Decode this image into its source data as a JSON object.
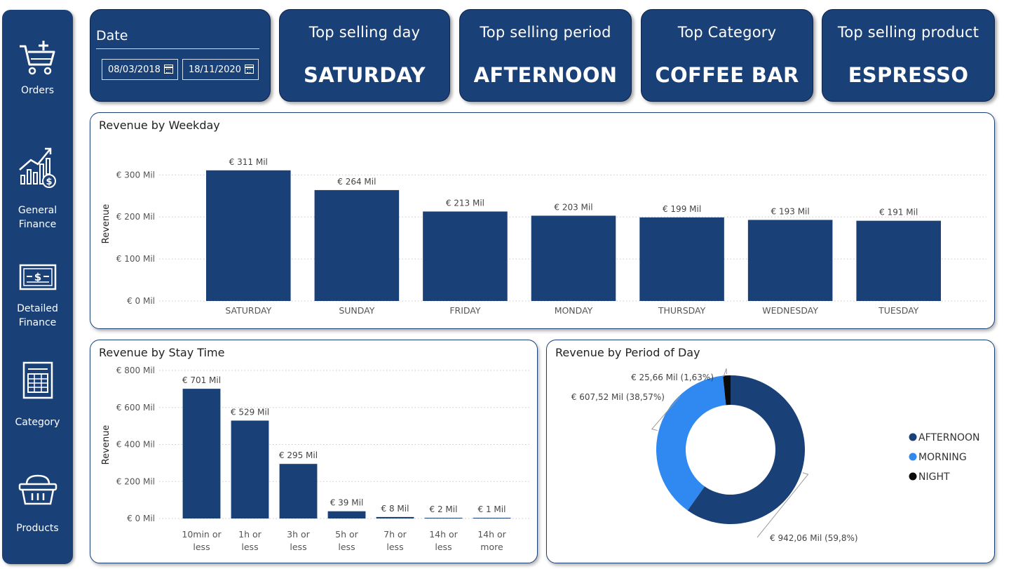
{
  "sidebar": {
    "items": [
      {
        "label": "Orders",
        "icon": "cart-plus-icon"
      },
      {
        "label": "General\nFinance",
        "icon": "finance-chart-icon"
      },
      {
        "label": "Detailed\nFinance",
        "icon": "banknote-icon"
      },
      {
        "label": "Category",
        "icon": "spreadsheet-icon"
      },
      {
        "label": "Products",
        "icon": "basket-icon"
      }
    ]
  },
  "date_filter": {
    "title": "Date",
    "start": "08/03/2018",
    "end": "18/11/2020"
  },
  "kpis": [
    {
      "title": "Top selling day",
      "value": "SATURDAY"
    },
    {
      "title": "Top selling period",
      "value": "AFTERNOON"
    },
    {
      "title": "Top Category",
      "value": "COFFEE BAR"
    },
    {
      "title": "Top selling product",
      "value": "ESPRESSO"
    }
  ],
  "colors": {
    "primary": "#1a4078",
    "morning": "#2f89f0",
    "night": "#0a0a0a",
    "gridline": "#c8c8c8"
  },
  "chart_data": [
    {
      "type": "bar",
      "title": "Revenue by Weekday",
      "ylabel": "Revenue",
      "categories": [
        "SATURDAY",
        "SUNDAY",
        "FRIDAY",
        "MONDAY",
        "THURSDAY",
        "WEDNESDAY",
        "TUESDAY"
      ],
      "values": [
        311,
        264,
        213,
        203,
        199,
        193,
        191
      ],
      "data_labels": [
        "€ 311 Mil",
        "€ 264 Mil",
        "€ 213 Mil",
        "€ 203 Mil",
        "€ 199 Mil",
        "€ 193 Mil",
        "€ 191 Mil"
      ],
      "yticks": [
        0,
        100,
        200,
        300
      ],
      "ytick_labels": [
        "€ 0 Mil",
        "€ 100 Mil",
        "€ 200 Mil",
        "€ 300 Mil"
      ],
      "ylim": [
        0,
        330
      ],
      "grid": true
    },
    {
      "type": "bar",
      "title": "Revenue by Stay Time",
      "ylabel": "Revenue",
      "categories": [
        "10min or less",
        "1h or less",
        "3h or less",
        "5h or less",
        "7h or less",
        "14h or less",
        "14h or more"
      ],
      "values": [
        701,
        529,
        295,
        39,
        8,
        2,
        1
      ],
      "data_labels": [
        "€ 701 Mil",
        "€ 529 Mil",
        "€ 295 Mil",
        "€ 39 Mil",
        "€ 8 Mil",
        "€ 2 Mil",
        "€ 1 Mil"
      ],
      "yticks": [
        0,
        200,
        400,
        600,
        800
      ],
      "ytick_labels": [
        "€ 0 Mil",
        "€ 200 Mil",
        "€ 400 Mil",
        "€ 600 Mil",
        "€ 800 Mil"
      ],
      "ylim": [
        0,
        800
      ],
      "grid": true
    },
    {
      "type": "pie",
      "variant": "donut",
      "title": "Revenue by Period of Day",
      "slices": [
        {
          "name": "AFTERNOON",
          "value": 942.06,
          "label": "€ 942,06 Mil (59,8%)"
        },
        {
          "name": "MORNING",
          "value": 607.52,
          "label": "€ 607,52 Mil (38,57%)"
        },
        {
          "name": "NIGHT",
          "value": 25.66,
          "label": "€ 25,66 Mil (1,63%)"
        }
      ],
      "legend_position": "right"
    }
  ]
}
